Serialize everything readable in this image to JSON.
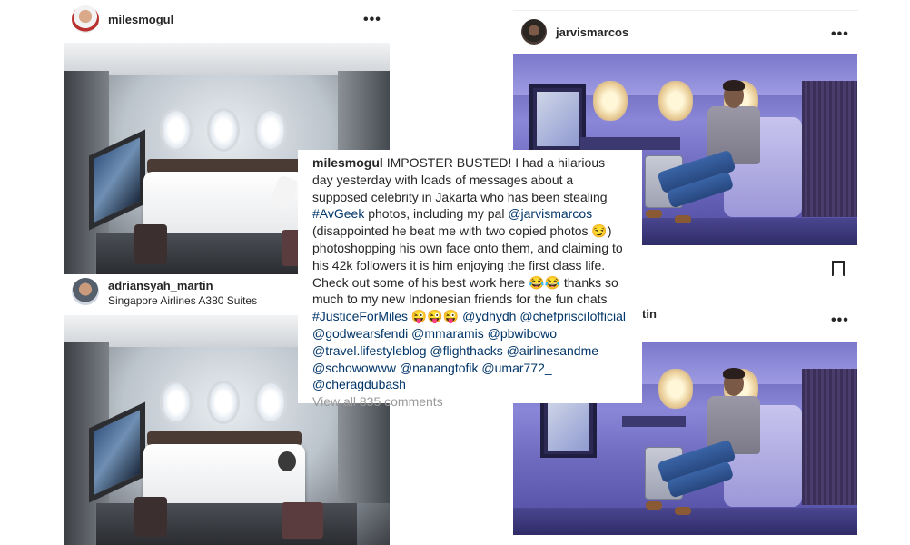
{
  "left_post": {
    "username": "milesmogul",
    "more": "•••"
  },
  "left_post2": {
    "username": "adriansyah_martin",
    "location": "Singapore Airlines A380 Suites"
  },
  "right_post": {
    "username": "jarvismarcos",
    "more": "•••"
  },
  "right_post2": {
    "username_partial": "tin",
    "more": "•••"
  },
  "caption": {
    "username": "milesmogul",
    "part1": "IMPOSTER BUSTED! I had a hilarious day yesterday with loads of messages about a supposed celebrity in Jakarta who has been stealing ",
    "tag_avgeek": "#AvGeek",
    "part2": " photos, including my pal ",
    "mention_jarvis": "@jarvismarcos",
    "part3": " (disappointed he beat me with two copied photos 😏) photoshopping his own face onto them, and claiming to his 42k followers it is him enjoying the first class life. Check out some of his best work here 😂😂 thanks so much to my new Indonesian friends for the fun chats ",
    "tag_justice": "#JusticeForMiles",
    "emoji_row": " 😜😜😜 ",
    "mentions": [
      "@ydhydh",
      "@chefprisciIofficial",
      "@godwearsfendi",
      "@mmaramis",
      "@pbwibowo",
      "@travel.lifestyleblog",
      "@flighthacks",
      "@airlinesandme",
      "@schowowww",
      "@nanangtofik",
      "@umar772_",
      "@cheragdubash"
    ],
    "view_comments": "View all 835 comments"
  },
  "icons": {
    "bookmark": "bookmark-icon",
    "more": "more-options-icon"
  }
}
